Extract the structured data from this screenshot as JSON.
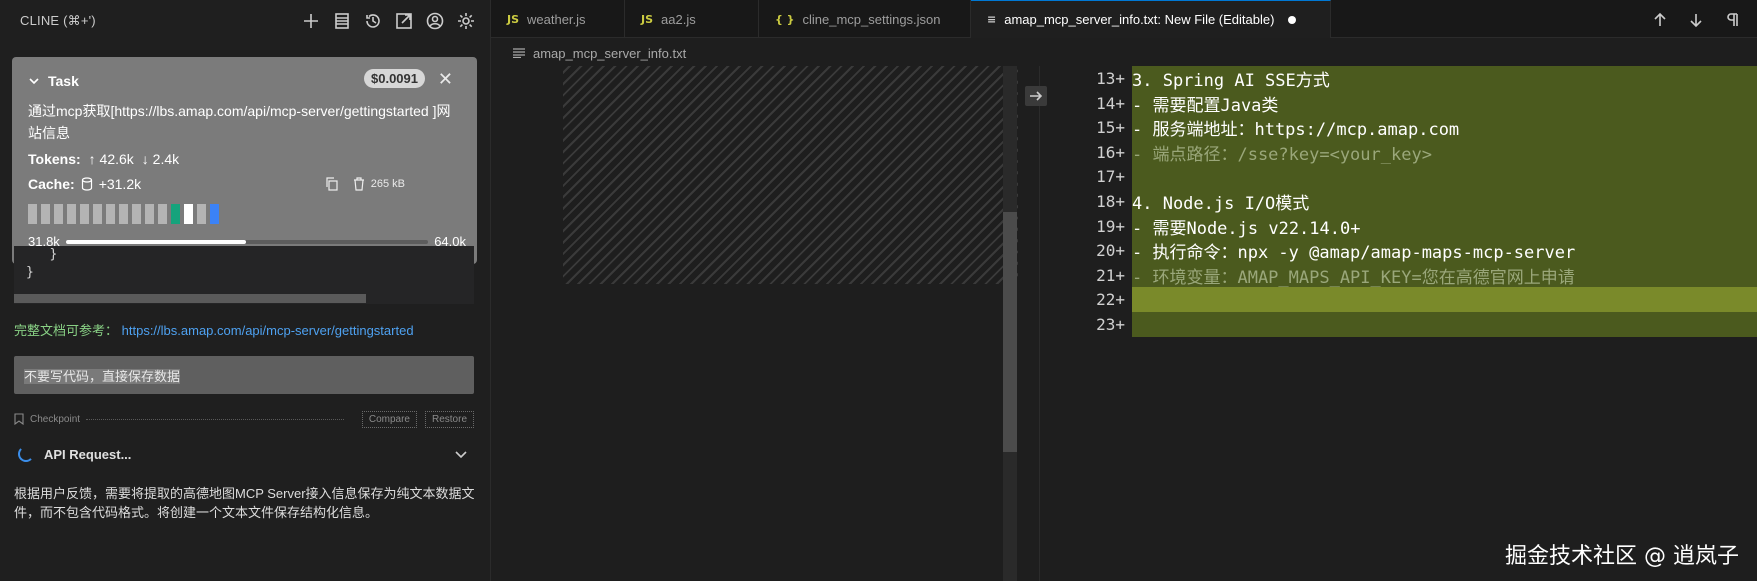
{
  "sidebar": {
    "title": "CLINE (⌘+')",
    "header_icons": [
      "plus-icon",
      "history-list-icon",
      "history-icon",
      "popout-icon",
      "account-icon",
      "settings-icon"
    ],
    "task": {
      "label": "Task",
      "cost": "$0.0091",
      "description": "通过mcp获取[https://lbs.amap.com/api/mcp-server/gettingstarted ]网站信息",
      "tokens_label": "Tokens:",
      "tokens_in": "↑ 42.6k",
      "tokens_out": "↓ 2.4k",
      "cache_label": "Cache:",
      "cache_value": "+31.2k",
      "size": "265 kB",
      "context_used": "31.8k",
      "context_max": "64.0k",
      "context_fraction": 0.497,
      "blocks": [
        "gray",
        "gray",
        "gray",
        "gray",
        "gray",
        "gray",
        "gray",
        "gray",
        "gray",
        "gray",
        "gray",
        "green",
        "white",
        "gray",
        "blue"
      ]
    },
    "code_snippet": "   }\n}",
    "doc_ref": {
      "prefix": "完整文档可参考：",
      "url": "https://lbs.amap.com/api/mcp-server/gettingstarted"
    },
    "user_message": "不要写代码，直接保存数据",
    "checkpoint": {
      "label": "Checkpoint",
      "compare": "Compare",
      "restore": "Restore"
    },
    "api_request": "API Request...",
    "assistant_message": "根据用户反馈，需要将提取的高德地图MCP Server接入信息保存为纯文本数据文件，而不包含代码格式。将创建一个文本文件保存结构化信息。"
  },
  "editor": {
    "tabs": [
      {
        "icon": "JS",
        "label": "weather.js"
      },
      {
        "icon": "JS",
        "label": "aa2.js"
      },
      {
        "icon": "{ }",
        "label": "cline_mcp_settings.json"
      },
      {
        "icon": "≡",
        "label": "amap_mcp_server_info.txt: New File (Editable)"
      }
    ],
    "breadcrumb": "amap_mcp_server_info.txt",
    "lines": [
      {
        "num": "13+",
        "text": "3. Spring AI SSE方式",
        "style": "normal"
      },
      {
        "num": "14+",
        "text": "- 需要配置Java类",
        "style": "normal"
      },
      {
        "num": "15+",
        "text": "- 服务端地址：https://mcp.amap.com",
        "style": "normal"
      },
      {
        "num": "16+",
        "text": "- 端点路径：/sse?key=<your_key>",
        "style": "dim"
      },
      {
        "num": "17+",
        "text": "",
        "style": "normal"
      },
      {
        "num": "18+",
        "text": "4. Node.js I/O模式",
        "style": "normal"
      },
      {
        "num": "19+",
        "text": "- 需要Node.js v22.14.0+",
        "style": "normal"
      },
      {
        "num": "20+",
        "text": "- 执行命令：npx -y @amap/amap-maps-mcp-server",
        "style": "normal"
      },
      {
        "num": "21+",
        "text": "- 环境变量：AMAP_MAPS_API_KEY=您在高德官网上申请",
        "style": "dim"
      },
      {
        "num": "22+",
        "text": "",
        "style": "hl"
      },
      {
        "num": "23+",
        "text": "",
        "style": "normal"
      }
    ]
  },
  "watermark": "掘金技术社区 @ 逍岚子"
}
